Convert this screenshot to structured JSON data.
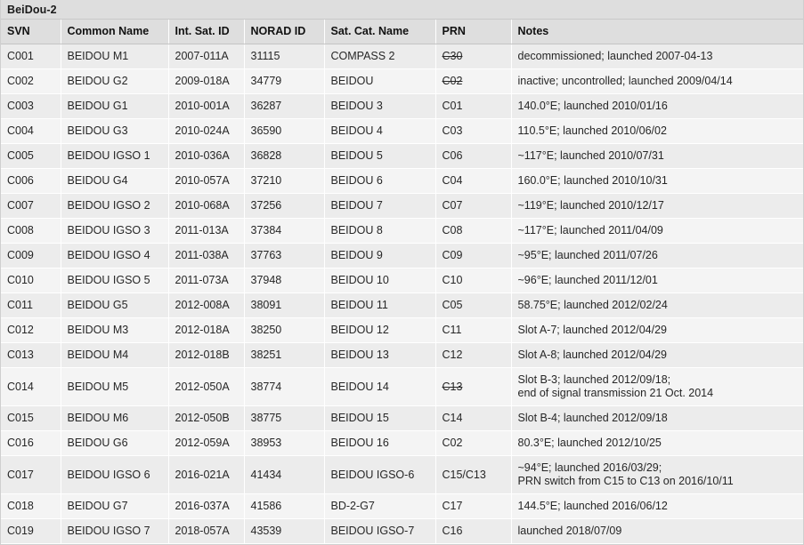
{
  "title": "BeiDou-2",
  "columns": [
    {
      "key": "svn",
      "label": "SVN"
    },
    {
      "key": "common",
      "label": "Common Name"
    },
    {
      "key": "intsat",
      "label": "Int. Sat. ID"
    },
    {
      "key": "norad",
      "label": "NORAD ID"
    },
    {
      "key": "satcat",
      "label": "Sat. Cat. Name"
    },
    {
      "key": "prn",
      "label": "PRN"
    },
    {
      "key": "notes",
      "label": "Notes"
    }
  ],
  "colors": {
    "title_band": "#dedede",
    "header_band": "#dedede",
    "row_odd": "#ececec",
    "row_even": "#f4f4f4",
    "grid_line": "#ffffff",
    "text": "#262626"
  },
  "rows": [
    {
      "svn": "C001",
      "common": "BEIDOU M1",
      "intsat": "2007-011A",
      "norad": "31115",
      "satcat": "COMPASS 2",
      "prn": "C30",
      "prn_struck": true,
      "notes": [
        "decommissioned; launched 2007-04-13"
      ]
    },
    {
      "svn": "C002",
      "common": "BEIDOU G2",
      "intsat": "2009-018A",
      "norad": "34779",
      "satcat": "BEIDOU",
      "prn": "C02",
      "prn_struck": true,
      "notes": [
        "inactive; uncontrolled; launched 2009/04/14"
      ]
    },
    {
      "svn": "C003",
      "common": "BEIDOU G1",
      "intsat": "2010-001A",
      "norad": "36287",
      "satcat": "BEIDOU 3",
      "prn": "C01",
      "prn_struck": false,
      "notes": [
        "140.0°E; launched 2010/01/16"
      ]
    },
    {
      "svn": "C004",
      "common": "BEIDOU G3",
      "intsat": "2010-024A",
      "norad": "36590",
      "satcat": "BEIDOU 4",
      "prn": "C03",
      "prn_struck": false,
      "notes": [
        "110.5°E; launched 2010/06/02"
      ]
    },
    {
      "svn": "C005",
      "common": "BEIDOU IGSO 1",
      "intsat": "2010-036A",
      "norad": "36828",
      "satcat": "BEIDOU 5",
      "prn": "C06",
      "prn_struck": false,
      "notes": [
        "~117°E; launched 2010/07/31"
      ]
    },
    {
      "svn": "C006",
      "common": "BEIDOU G4",
      "intsat": "2010-057A",
      "norad": "37210",
      "satcat": "BEIDOU 6",
      "prn": "C04",
      "prn_struck": false,
      "notes": [
        "160.0°E; launched 2010/10/31"
      ]
    },
    {
      "svn": "C007",
      "common": "BEIDOU IGSO 2",
      "intsat": "2010-068A",
      "norad": "37256",
      "satcat": "BEIDOU 7",
      "prn": "C07",
      "prn_struck": false,
      "notes": [
        "~119°E; launched 2010/12/17"
      ]
    },
    {
      "svn": "C008",
      "common": "BEIDOU IGSO 3",
      "intsat": "2011-013A",
      "norad": "37384",
      "satcat": "BEIDOU 8",
      "prn": "C08",
      "prn_struck": false,
      "notes": [
        "~117°E; launched 2011/04/09"
      ]
    },
    {
      "svn": "C009",
      "common": "BEIDOU IGSO 4",
      "intsat": "2011-038A",
      "norad": "37763",
      "satcat": "BEIDOU 9",
      "prn": "C09",
      "prn_struck": false,
      "notes": [
        "~95°E; launched 2011/07/26"
      ]
    },
    {
      "svn": "C010",
      "common": "BEIDOU IGSO 5",
      "intsat": "2011-073A",
      "norad": "37948",
      "satcat": "BEIDOU 10",
      "prn": "C10",
      "prn_struck": false,
      "notes": [
        "~96°E; launched 2011/12/01"
      ]
    },
    {
      "svn": "C011",
      "common": "BEIDOU G5",
      "intsat": "2012-008A",
      "norad": "38091",
      "satcat": "BEIDOU 11",
      "prn": "C05",
      "prn_struck": false,
      "notes": [
        "58.75°E; launched 2012/02/24"
      ]
    },
    {
      "svn": "C012",
      "common": "BEIDOU M3",
      "intsat": "2012-018A",
      "norad": "38250",
      "satcat": "BEIDOU 12",
      "prn": "C11",
      "prn_struck": false,
      "notes": [
        "Slot A-7; launched 2012/04/29"
      ]
    },
    {
      "svn": "C013",
      "common": "BEIDOU M4",
      "intsat": "2012-018B",
      "norad": "38251",
      "satcat": "BEIDOU 13",
      "prn": "C12",
      "prn_struck": false,
      "notes": [
        "Slot A-8; launched 2012/04/29"
      ]
    },
    {
      "svn": "C014",
      "common": "BEIDOU M5",
      "intsat": "2012-050A",
      "norad": "38774",
      "satcat": "BEIDOU 14",
      "prn": "C13",
      "prn_struck": true,
      "notes": [
        "Slot B-3; launched 2012/09/18;",
        "end of signal transmission 21 Oct. 2014"
      ]
    },
    {
      "svn": "C015",
      "common": "BEIDOU M6",
      "intsat": "2012-050B",
      "norad": "38775",
      "satcat": "BEIDOU 15",
      "prn": "C14",
      "prn_struck": false,
      "notes": [
        "Slot B-4; launched 2012/09/18"
      ]
    },
    {
      "svn": "C016",
      "common": "BEIDOU G6",
      "intsat": "2012-059A",
      "norad": "38953",
      "satcat": "BEIDOU 16",
      "prn": "C02",
      "prn_struck": false,
      "notes": [
        "80.3°E; launched 2012/10/25"
      ]
    },
    {
      "svn": "C017",
      "common": "BEIDOU IGSO 6",
      "intsat": "2016-021A",
      "norad": "41434",
      "satcat": "BEIDOU IGSO-6",
      "prn": "C15/C13",
      "prn_struck": false,
      "notes": [
        "~94°E; launched 2016/03/29;",
        "PRN switch from C15 to C13 on 2016/10/11"
      ]
    },
    {
      "svn": "C018",
      "common": "BEIDOU G7",
      "intsat": "2016-037A",
      "norad": "41586",
      "satcat": "BD-2-G7",
      "prn": "C17",
      "prn_struck": false,
      "notes": [
        "144.5°E; launched 2016/06/12"
      ]
    },
    {
      "svn": "C019",
      "common": "BEIDOU IGSO 7",
      "intsat": "2018-057A",
      "norad": "43539",
      "satcat": "BEIDOU IGSO-7",
      "prn": "C16",
      "prn_struck": false,
      "notes": [
        "launched 2018/07/09"
      ]
    }
  ]
}
